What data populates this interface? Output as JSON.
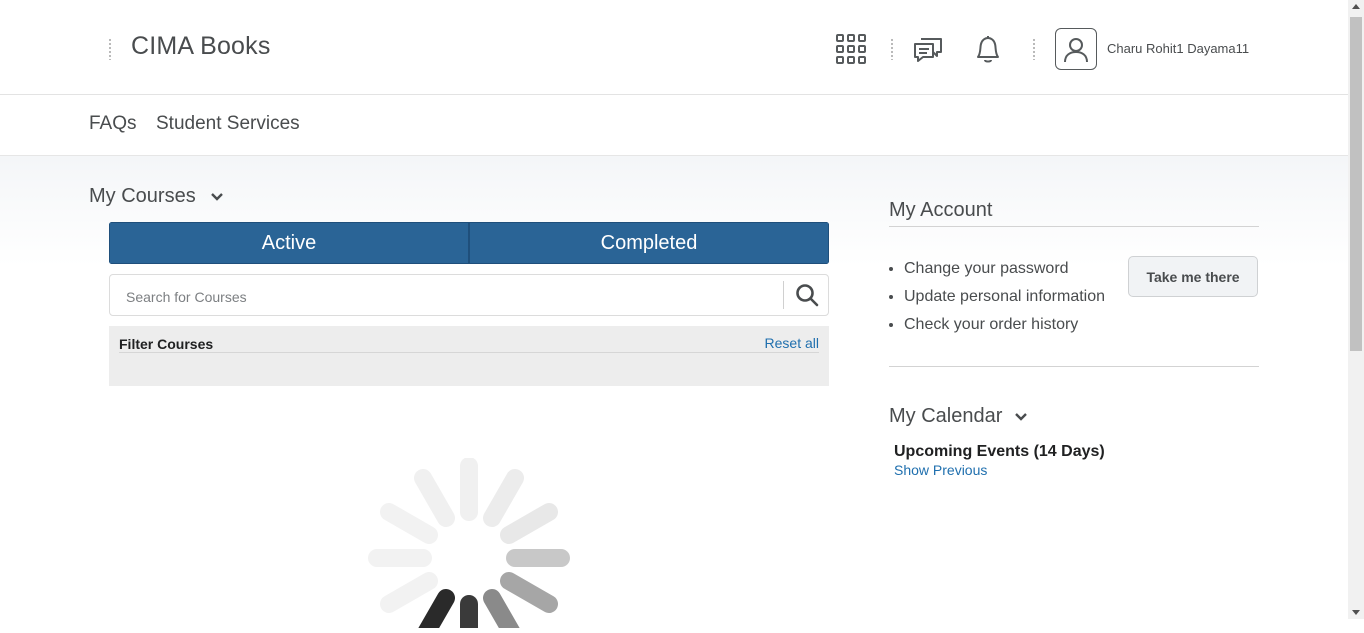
{
  "header": {
    "brand": "CIMA Books",
    "icons": [
      "waffle-icon",
      "chat-icon",
      "bell-icon",
      "user-avatar-icon"
    ],
    "username": "Charu Rohit1 Dayama11"
  },
  "nav": {
    "items": [
      {
        "label": "FAQs"
      },
      {
        "label": "Student Services"
      }
    ]
  },
  "courses": {
    "title": "My Courses",
    "tabs": [
      {
        "label": "Active",
        "selected": true
      },
      {
        "label": "Completed",
        "selected": false
      }
    ],
    "search_placeholder": "Search for Courses",
    "filter_label": "Filter Courses",
    "reset_label": "Reset all"
  },
  "account": {
    "title": "My Account",
    "items": [
      "Change your password",
      "Update personal information",
      "Check your order history"
    ],
    "button_label": "Take me there"
  },
  "calendar": {
    "title": "My Calendar",
    "upcoming": "Upcoming Events (14 Days)",
    "show_previous": "Show Previous"
  },
  "colors": {
    "tab_bg": "#2a6496",
    "link": "#1f6fae",
    "text": "#494c4e"
  }
}
